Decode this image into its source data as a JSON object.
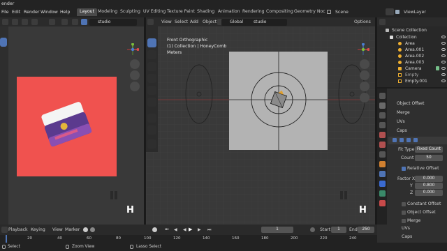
{
  "app": {
    "title": "ender"
  },
  "menu": [
    "File",
    "Edit",
    "Render",
    "Window",
    "Help"
  ],
  "workspaces": [
    "Layout",
    "Modeling",
    "Sculpting",
    "UV Editing",
    "Texture Paint",
    "Shading",
    "Animation",
    "Rendering",
    "Compositing",
    "Geometry Noc"
  ],
  "active_workspace": "Layout",
  "scene": {
    "label": "Scene",
    "viewlayer": "ViewLayer"
  },
  "left_viewport": {
    "header_menu": [
      "View",
      "Slot"
    ],
    "studio_label": "studio",
    "overlay_letter": "H"
  },
  "main_viewport": {
    "header_menu": [
      "View",
      "Select",
      "Add",
      "Object"
    ],
    "transform_orientation": "Global",
    "studio_label": "studio",
    "options_label": "Options",
    "info_line1": "Front Orthographic",
    "info_line2": "(1) Collection | HoneyComb",
    "info_line3": "Meters",
    "overlay_letter": "H"
  },
  "outliner": {
    "root": "Scene Collection",
    "collection": "Collection",
    "items": [
      "Area",
      "Area.001",
      "Area.002",
      "Area.003",
      "Camera",
      "Empty",
      "Empty.001"
    ]
  },
  "properties": {
    "top_sections": [
      "Object Offset",
      "Merge",
      "UVs",
      "Caps"
    ],
    "fit_type_label": "Fit Type",
    "fit_type_value": "Fixed Count",
    "count_label": "Count",
    "count_value": "50",
    "relative_offset_label": "Relative Offset",
    "factor_x_label": "Factor X",
    "factor_x": "0.000",
    "factor_y_label": "Y",
    "factor_y": "0.800",
    "factor_z_label": "Z",
    "factor_z": "0.000",
    "bottom_sections": [
      "Constant Offset",
      "Object Offset",
      "Merge",
      "UVs",
      "Caps"
    ]
  },
  "timeline": {
    "menu": [
      "Playback",
      "Keying",
      "View",
      "Marker"
    ],
    "current_frame": "1",
    "start_label": "Start",
    "start_value": "1",
    "end_label": "End",
    "end_value": "250",
    "ruler": [
      "20",
      "40",
      "60",
      "80",
      "100",
      "120",
      "140",
      "160",
      "180",
      "200",
      "220",
      "240"
    ]
  },
  "statusbar": {
    "left": "Select",
    "middle": "Zoom View",
    "right": "Lasso Select"
  },
  "colors": {
    "accent": "#4f74b5",
    "render_bg": "#f0524f",
    "plane": "#b3b3b3"
  }
}
